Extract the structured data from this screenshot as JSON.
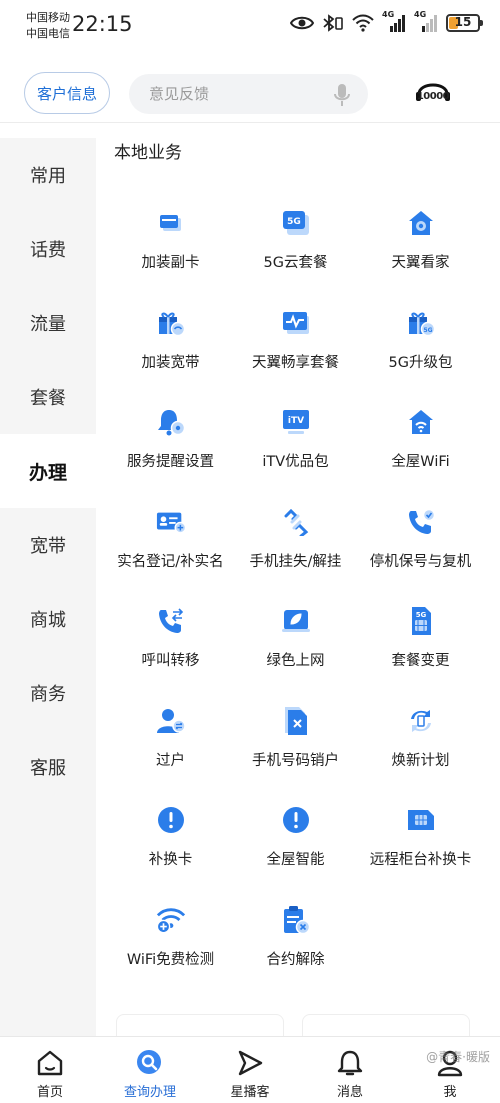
{
  "status": {
    "carrier1": "中国移动",
    "carrier2": "中国电信",
    "time": "22:15",
    "signal1": "4G",
    "signal2": "4G",
    "battery": "15"
  },
  "header": {
    "customer_info": "客户信息",
    "search_placeholder": "意见反馈",
    "hotline": "10000"
  },
  "sidebar": {
    "items": [
      {
        "label": "常用"
      },
      {
        "label": "话费"
      },
      {
        "label": "流量"
      },
      {
        "label": "套餐"
      },
      {
        "label": "办理"
      },
      {
        "label": "宽带"
      },
      {
        "label": "商城"
      },
      {
        "label": "商务"
      },
      {
        "label": "客服"
      }
    ],
    "active_index": 4
  },
  "main": {
    "section_title": "本地业务",
    "services": [
      {
        "label": "加装副卡",
        "icon": "sim-card-icon"
      },
      {
        "label": "5G云套餐",
        "icon": "5g-cloud-icon"
      },
      {
        "label": "天翼看家",
        "icon": "home-camera-icon"
      },
      {
        "label": "加装宽带",
        "icon": "gift-broadband-icon"
      },
      {
        "label": "天翼畅享套餐",
        "icon": "monitor-pulse-icon"
      },
      {
        "label": "5G升级包",
        "icon": "gift-5g-icon"
      },
      {
        "label": "服务提醒设置",
        "icon": "bell-settings-icon"
      },
      {
        "label": "iTV优品包",
        "icon": "itv-icon"
      },
      {
        "label": "全屋WiFi",
        "icon": "home-wifi-icon"
      },
      {
        "label": "实名登记/补实名",
        "icon": "id-card-icon"
      },
      {
        "label": "手机挂失/解挂",
        "icon": "link-broken-icon"
      },
      {
        "label": "停机保号与复机",
        "icon": "phone-check-icon"
      },
      {
        "label": "呼叫转移",
        "icon": "call-forward-icon"
      },
      {
        "label": "绿色上网",
        "icon": "green-leaf-screen-icon"
      },
      {
        "label": "套餐变更",
        "icon": "sim-5g-icon"
      },
      {
        "label": "过户",
        "icon": "user-transfer-icon"
      },
      {
        "label": "手机号码销户",
        "icon": "cancel-sim-icon"
      },
      {
        "label": "焕新计划",
        "icon": "refresh-phone-icon"
      },
      {
        "label": "补换卡",
        "icon": "exclamation-icon"
      },
      {
        "label": "全屋智能",
        "icon": "exclamation-icon"
      },
      {
        "label": "远程柜台补换卡",
        "icon": "sim-chip-icon"
      },
      {
        "label": "WiFi免费检测",
        "icon": "wifi-add-icon"
      },
      {
        "label": "合约解除",
        "icon": "clipboard-cancel-icon"
      }
    ]
  },
  "bottom_nav": [
    {
      "label": "首页",
      "icon": "home-icon"
    },
    {
      "label": "查询办理",
      "icon": "search-icon"
    },
    {
      "label": "星播客",
      "icon": "play-icon"
    },
    {
      "label": "消息",
      "icon": "bell-icon"
    },
    {
      "label": "我",
      "icon": "user-icon"
    }
  ],
  "watermark": "@青春·暖版",
  "colors": {
    "accent": "#1f6fd6",
    "icon_blue": "#2b7de9",
    "icon_light": "#bcd8fb"
  }
}
